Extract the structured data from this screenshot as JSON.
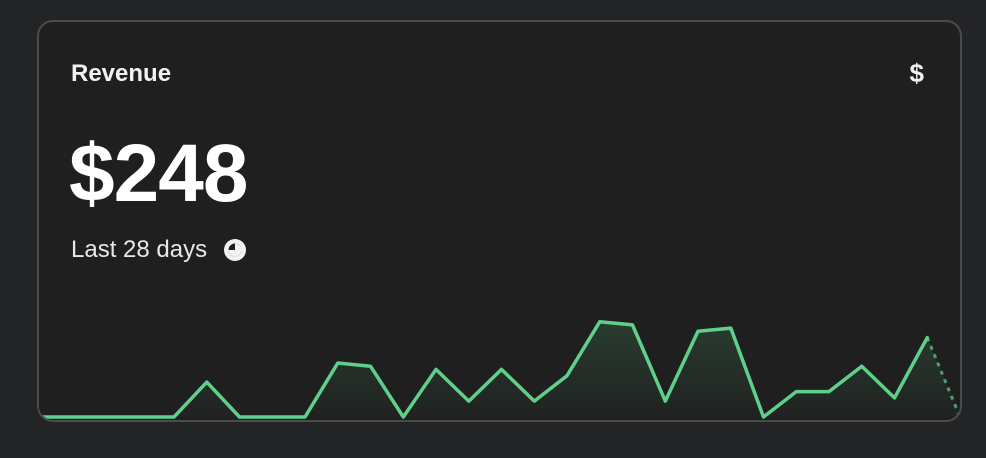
{
  "card": {
    "title": "Revenue",
    "value": "$248",
    "period": "Last 28 days",
    "currency_icon": "dollar-sign-icon",
    "period_icon": "clock-icon"
  },
  "colors": {
    "background": "#232426",
    "card_background": "#1f1f1f",
    "border": "#4a4b4e",
    "line": "#5fd08a",
    "text": "#ffffff"
  },
  "chart_data": {
    "type": "area",
    "series": [
      {
        "values": [
          0,
          0,
          0,
          0,
          0,
          11,
          0,
          0,
          0,
          17,
          16,
          0,
          15,
          5,
          15,
          5,
          13,
          30,
          29,
          5,
          27,
          28,
          0,
          8,
          8,
          16,
          6,
          25,
          0
        ],
        "last_segment_projected": true
      }
    ],
    "ylim": [
      0,
      34
    ]
  }
}
